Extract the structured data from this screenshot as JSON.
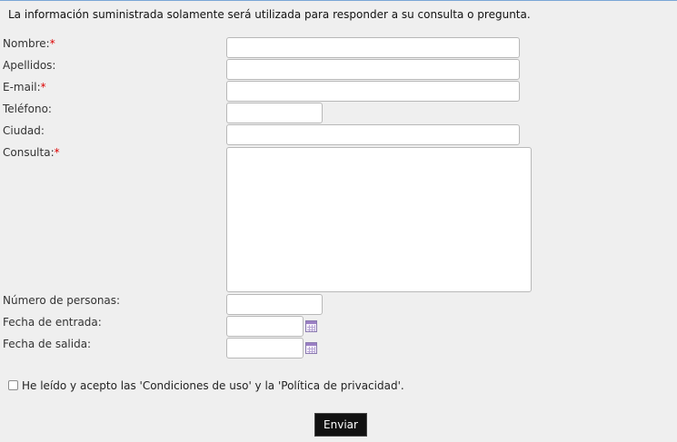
{
  "intro": "La información suministrada solamente será utilizada para responder a su consulta o pregunta.",
  "required_marker": "*",
  "fields": {
    "nombre": {
      "label": "Nombre:",
      "value": ""
    },
    "apellidos": {
      "label": "Apellidos:",
      "value": ""
    },
    "email": {
      "label": "E-mail:",
      "value": ""
    },
    "telefono": {
      "label": "Teléfono:",
      "value": ""
    },
    "ciudad": {
      "label": "Ciudad:",
      "value": ""
    },
    "consulta": {
      "label": "Consulta:",
      "value": ""
    },
    "personas": {
      "label": "Número de personas:",
      "value": ""
    },
    "entrada": {
      "label": "Fecha de entrada:",
      "value": ""
    },
    "salida": {
      "label": "Fecha de salida:",
      "value": ""
    }
  },
  "terms": {
    "label": "He leído y acepto las 'Condiciones de uso' y la 'Política de privacidad'.",
    "checked": false
  },
  "submit_label": "Enviar",
  "colors": {
    "required": "#dd0000",
    "button_bg": "#111111",
    "calendar_icon": "#9b7fc4"
  }
}
